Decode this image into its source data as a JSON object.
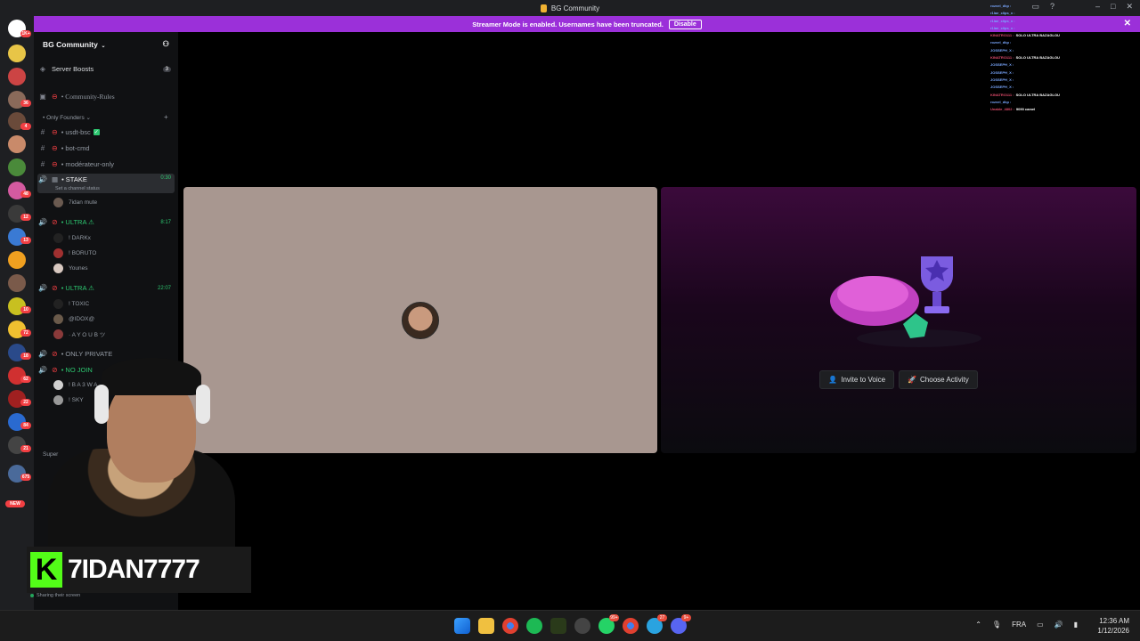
{
  "window": {
    "title": "BG Community"
  },
  "banner": {
    "text": "Streamer Mode is enabled. Usernames have been truncated.",
    "disable_label": "Disable"
  },
  "rail": {
    "badges": [
      "1K+",
      "36",
      "4",
      "48",
      "12",
      "13",
      "10",
      "72",
      "18",
      "62",
      "22",
      "84",
      "21",
      "675",
      "NEW"
    ]
  },
  "sidebar": {
    "server_name": "BG Community",
    "boosts_label": "Server Boosts",
    "boosts_count": "3",
    "rules_channel": "• Community-Rules",
    "category_founders": "• Only Founders",
    "channels": [
      {
        "name": "• usdt-bsc"
      },
      {
        "name": "• bot-cmd"
      },
      {
        "name": "• modérateur-only"
      }
    ],
    "stake": {
      "name": "• STAKE",
      "timer": "0:30",
      "status": "Set a channel status"
    },
    "stake_users": [
      "7idan mute"
    ],
    "ultra1": {
      "name": "• ULTRA ⚠",
      "timer": "8:17"
    },
    "ultra1_users": [
      "! DARKx",
      "! BORUTO",
      "Younes"
    ],
    "ultra2": {
      "name": "• ULTRA ⚠",
      "timer": "22:07"
    },
    "ultra2_users": [
      "! TOXIC",
      "@IDOX@",
      "· A Y O U B ツ"
    ],
    "only_private": "• ONLY PRIVATE",
    "no_join": "• NO JOIN",
    "no_join_users": [
      "! B A 3 W A",
      "! SKY"
    ],
    "category_super": "Super",
    "sharing_text": "Sharing their screen"
  },
  "stage": {
    "invite_label": "Invite to Voice",
    "activity_label": "Choose Activity"
  },
  "chat_overlay": [
    {
      "user": "rozvel_dkp :",
      "msg": ""
    },
    {
      "user": "r1lae_clips_x :",
      "msg": ""
    },
    {
      "user": "r1lae_clips_x :",
      "msg": ""
    },
    {
      "user": "r1lae_clips_x :",
      "msg": ""
    },
    {
      "user": "KINATRO111 :",
      "msg": "SOLO ULTRA BAZAGLOU"
    },
    {
      "user": "rozvel_dkp :",
      "msg": ""
    },
    {
      "user": "JOSSEPH_X :",
      "msg": ""
    },
    {
      "user": "KINATRO111 :",
      "msg": "SOLO ULTRA BAZAGLOU"
    },
    {
      "user": "JOSSEPH_X :",
      "msg": ""
    },
    {
      "user": "JOSSEPH_X :",
      "msg": ""
    },
    {
      "user": "JOSSEPH_X :",
      "msg": ""
    },
    {
      "user": "JOSSEPH_X :",
      "msg": ""
    },
    {
      "user": "KINATRO111 :",
      "msg": "SOLO ULTRA BAZAGLOU"
    },
    {
      "user": "rozvel_dkp :",
      "msg": ""
    },
    {
      "user": "Unable_4802 :",
      "msg": "9090 camel"
    }
  ],
  "nameplate": {
    "logo": "K",
    "name": "7IDAN7777"
  },
  "taskbar": {
    "badges": {
      "whatsapp": "99+",
      "telegram": "27",
      "discord": "9+"
    },
    "lang": "FRA",
    "time": "12:36 AM",
    "date": "1/12/2026"
  },
  "colors": {
    "banner": "#9b30d9",
    "voice_green": "#2dc770",
    "kick_green": "#53fc18",
    "left_tile": "#a89790"
  }
}
